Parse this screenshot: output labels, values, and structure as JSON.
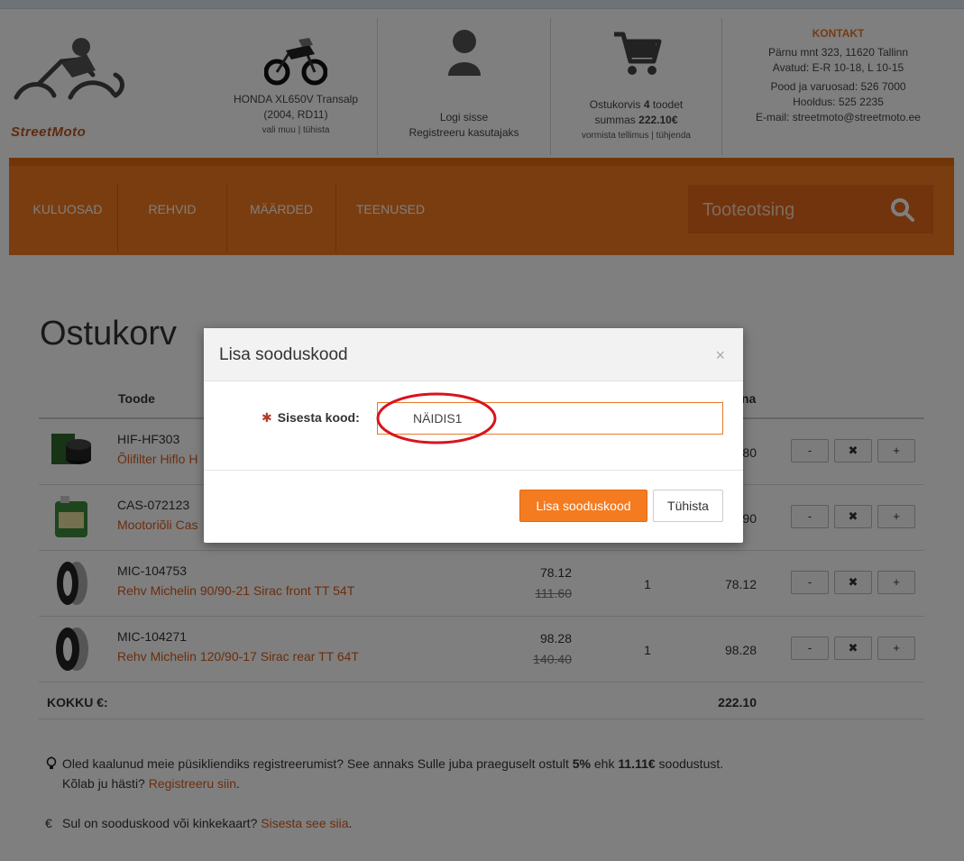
{
  "brand": {
    "logo_text": "StreetMoto"
  },
  "header": {
    "bike": {
      "line1": "HONDA XL650V Transalp",
      "line2": "(2004, RD11)",
      "link_choose": "vali muu",
      "link_sep": " | ",
      "link_cancel": "tühista"
    },
    "account": {
      "login": "Logi sisse",
      "register": "Registreeru kasutajaks"
    },
    "cart": {
      "prefix": "Ostukorvis ",
      "count": "4",
      "suffix": " toodet",
      "sum_prefix": "summas ",
      "sum": "222.10€",
      "link_checkout": "vormista tellimus",
      "link_sep": " | ",
      "link_empty": "tühjenda"
    },
    "contact": {
      "title": "KONTAKT",
      "address": "Pärnu mnt 323, 11620 Tallinn",
      "hours": "Avatud: E-R 10-18, L 10-15",
      "shop_phone": "Pood ja varuosad: 526 7000",
      "service_phone": "Hooldus: 525 2235",
      "email": "E-mail: streetmoto@streetmoto.ee"
    }
  },
  "nav": {
    "items": [
      "KULUOSAD",
      "REHVID",
      "MÄÄRDED",
      "TEENUSED"
    ],
    "search_placeholder": "Tooteotsing"
  },
  "page": {
    "title": "Ostukorv"
  },
  "table": {
    "headers": {
      "product": "Toode",
      "total_partial": "na"
    },
    "rows": [
      {
        "sku": "HIF-HF303",
        "name": "Õlifilter Hiflo H",
        "total": "80",
        "img": "oil-filter"
      },
      {
        "sku": "CAS-072123",
        "name": "Mootoriõli Cas",
        "total": "90",
        "img": "oil-can"
      },
      {
        "sku": "MIC-104753",
        "name": "Rehv Michelin 90/90-21 Sirac front TT 54T",
        "price": "78.12",
        "old_price": "111.60",
        "qty": "1",
        "total": "78.12",
        "img": "tire"
      },
      {
        "sku": "MIC-104271",
        "name": "Rehv Michelin 120/90-17 Sirac rear TT 64T",
        "price": "98.28",
        "old_price": "140.40",
        "qty": "1",
        "total": "98.28",
        "img": "tire"
      }
    ],
    "buttons": {
      "minus": "-",
      "remove": "✖",
      "plus": "+"
    },
    "sum_label": "KOKKU €:",
    "sum_value": "222.10"
  },
  "info": {
    "register_line1_a": "Oled kaalunud meie püsikliendiks registreerumist? See annaks Sulle juba praeguselt ostult ",
    "register_pct": "5%",
    "register_mid": " ehk ",
    "register_amount": "11.11€",
    "register_end": " soodustust.",
    "register_line2": "Kõlab ju hästi? ",
    "register_link": "Registreeru siin",
    "register_dot": ".",
    "coupon_icon": "€",
    "coupon_text": "Sul on sooduskood või kinkekaart? ",
    "coupon_link": "Sisesta see siia",
    "coupon_dot": "."
  },
  "modal": {
    "title": "Lisa sooduskood",
    "close": "×",
    "required_mark": "✱",
    "label": "Sisesta kood:",
    "input_value": "NÄIDIS1",
    "submit": "Lisa sooduskood",
    "cancel": "Tühista"
  },
  "colors": {
    "accent": "#f47b20",
    "accent_dark": "#e36a15",
    "link": "#d85a1a",
    "annotation": "#d8141c"
  }
}
